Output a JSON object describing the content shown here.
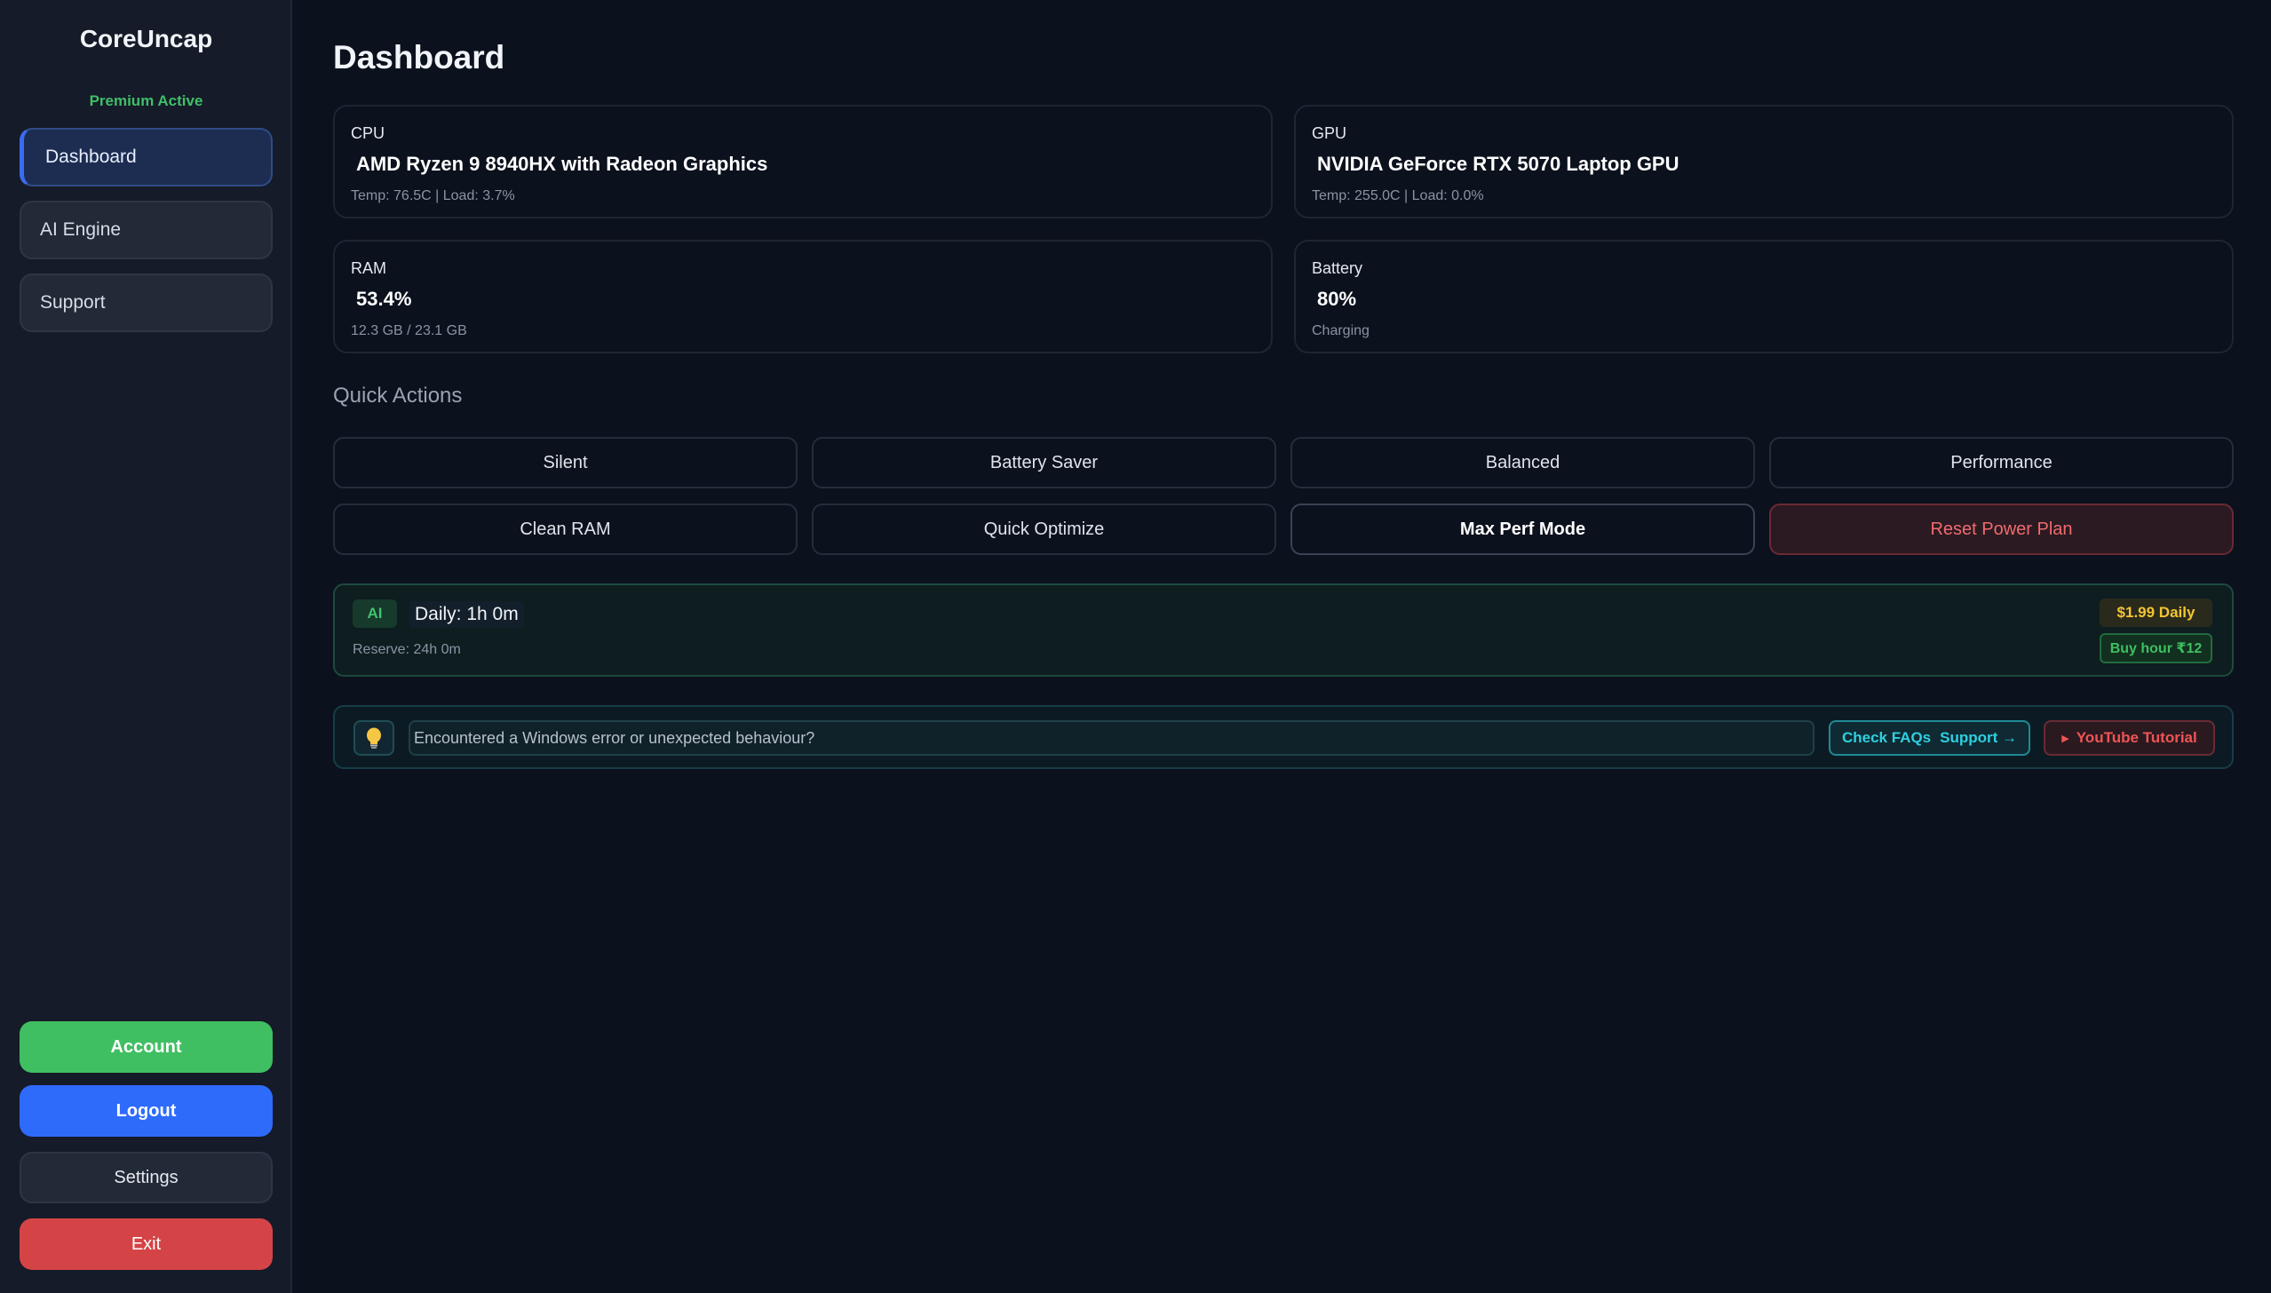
{
  "sidebar": {
    "brand": "CoreUncap",
    "premium_status": "Premium Active",
    "nav": [
      {
        "label": "Dashboard",
        "active": true
      },
      {
        "label": "AI Engine",
        "active": false
      },
      {
        "label": "Support",
        "active": false
      }
    ],
    "buttons": {
      "account": "Account",
      "logout": "Logout",
      "settings": "Settings",
      "exit": "Exit"
    }
  },
  "page": {
    "title": "Dashboard"
  },
  "stats": {
    "cpu": {
      "label": "CPU",
      "value": "AMD Ryzen 9 8940HX with Radeon Graphics",
      "sub": "Temp: 76.5C | Load: 3.7%"
    },
    "gpu": {
      "label": "GPU",
      "value": "NVIDIA GeForce RTX 5070 Laptop GPU",
      "sub": "Temp: 255.0C | Load: 0.0%"
    },
    "ram": {
      "label": "RAM",
      "value": "53.4%",
      "sub": "12.3 GB / 23.1 GB"
    },
    "battery": {
      "label": "Battery",
      "value": "80%",
      "sub": "Charging"
    }
  },
  "quick_actions": {
    "title": "Quick Actions",
    "row1": [
      "Silent",
      "Battery Saver",
      "Balanced",
      "Performance"
    ],
    "row2": [
      "Clean RAM",
      "Quick Optimize",
      "Max Perf Mode",
      "Reset Power Plan"
    ]
  },
  "ai": {
    "badge": "AI",
    "daily": "Daily: 1h 0m",
    "reserve": "Reserve: 24h 0m",
    "price": "$1.99 Daily",
    "buy": "Buy hour ₹12"
  },
  "help": {
    "icon": "lightbulb-icon",
    "prompt": "Encountered a Windows error or unexpected behaviour?",
    "faq_label": "Check FAQs",
    "support_label": "Support →",
    "youtube_label": "YouTube Tutorial"
  },
  "colors": {
    "background": "#0b111d",
    "sidebar": "#151b28",
    "accent_blue": "#2f6bfb",
    "accent_green": "#3fbf62",
    "danger_red": "#d44446",
    "cyan": "#2fd0e0",
    "gold": "#f4c532"
  }
}
